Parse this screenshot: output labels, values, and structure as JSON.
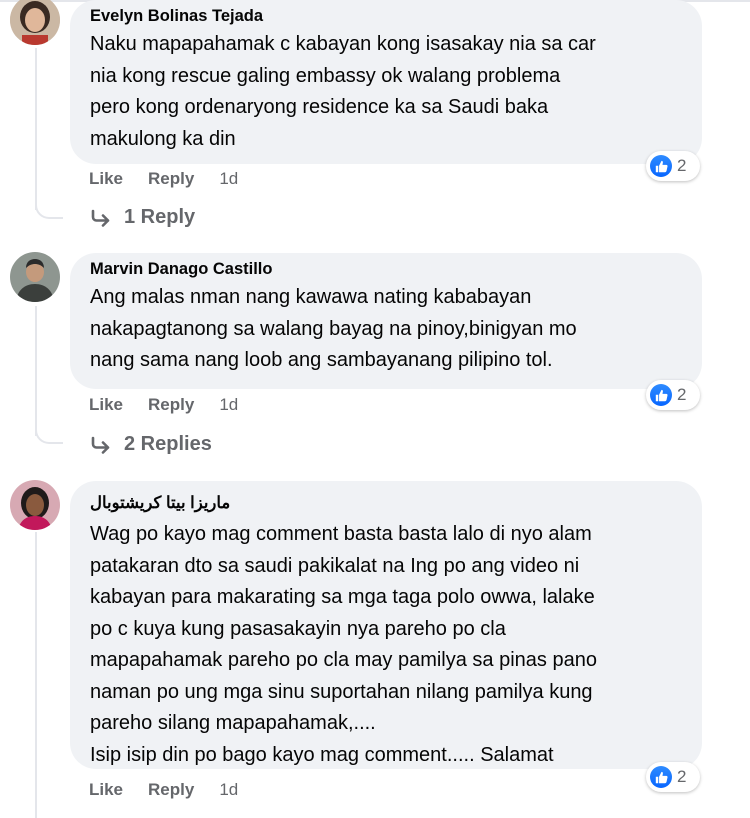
{
  "comments": [
    {
      "author": "Evelyn Bolinas Tejada",
      "avatar": "avatar-woman-icon",
      "lines": [
        "Naku mapapahamak c kabayan kong isasakay nia sa car",
        "nia kong rescue galing embassy ok walang problema",
        "pero kong ordenaryong residence ka sa Saudi baka",
        "makulong ka din"
      ],
      "like_label": "Like",
      "reply_label": "Reply",
      "time": "1d",
      "reaction_count": "2",
      "replies_label": "1 Reply"
    },
    {
      "author": "Marvin Danago Castillo",
      "avatar": "avatar-man-icon",
      "lines": [
        "Ang malas nman nang kawawa nating kababayan",
        "nakapagtanong sa walang bayag na pinoy,binigyan mo",
        "nang sama nang loob ang sambayanang pilipino tol."
      ],
      "like_label": "Like",
      "reply_label": "Reply",
      "time": "1d",
      "reaction_count": "2",
      "replies_label": "2 Replies"
    },
    {
      "author": "ماريزا بيتا كريشتوبال",
      "avatar": "avatar-woman-icon",
      "lines": [
        "Wag po kayo mag comment basta basta lalo di nyo alam",
        "patakaran dto sa saudi pakikalat na Ing po ang video ni",
        "kabayan para makarating sa mga taga polo owwa, lalake",
        "po c kuya kung pasasakayin nya pareho po cla",
        "mapapahamak pareho po cla may pamilya sa pinas pano",
        "naman po ung mga sinu suportahan nilang pamilya kung",
        "pareho silang mapapahamak,....",
        "Isip isip din po bago kayo mag comment..... Salamat"
      ],
      "like_label": "Like",
      "reply_label": "Reply",
      "time": "1d",
      "reaction_count": "2"
    }
  ],
  "colors": {
    "bubble": "#f0f2f5",
    "secondary_text": "#65676b",
    "like_blue": "#0866ff"
  }
}
